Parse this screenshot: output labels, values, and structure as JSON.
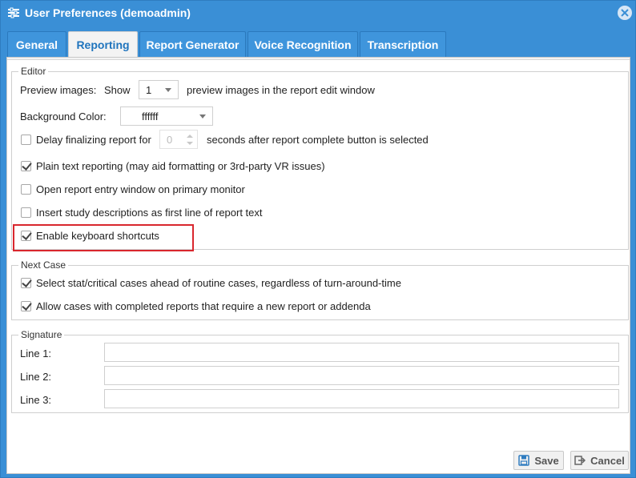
{
  "window": {
    "title": "User Preferences (demoadmin)"
  },
  "tabs": [
    {
      "label": "General",
      "active": false
    },
    {
      "label": "Reporting",
      "active": true
    },
    {
      "label": "Report Generator",
      "active": false
    },
    {
      "label": "Voice Recognition",
      "active": false
    },
    {
      "label": "Transcription",
      "active": false
    }
  ],
  "editor": {
    "legend": "Editor",
    "preview": {
      "label": "Preview images:",
      "show": "Show",
      "value": "1",
      "suffix": "preview images in the report edit window"
    },
    "background": {
      "label": "Background Color:",
      "value": "ffffff"
    },
    "delay": {
      "label": "Delay finalizing report for",
      "value": "0",
      "suffix": "seconds after report complete button is selected",
      "checked": false
    },
    "plain_text": {
      "label": "Plain text reporting (may aid formatting or 3rd-party VR issues)",
      "checked": true
    },
    "open_primary": {
      "label": "Open report entry window on primary monitor",
      "checked": false
    },
    "insert_desc": {
      "label": "Insert study descriptions as first line of report text",
      "checked": false
    },
    "shortcuts": {
      "label": "Enable keyboard shortcuts",
      "checked": true
    }
  },
  "next_case": {
    "legend": "Next Case",
    "stat": {
      "label": "Select stat/critical cases ahead of routine cases, regardless of turn-around-time",
      "checked": true
    },
    "allow": {
      "label": "Allow cases with completed reports that require a new report or addenda",
      "checked": true
    }
  },
  "signature": {
    "legend": "Signature",
    "line1": {
      "label": "Line 1:",
      "value": ""
    },
    "line2": {
      "label": "Line 2:",
      "value": ""
    },
    "line3": {
      "label": "Line 3:",
      "value": ""
    }
  },
  "buttons": {
    "save": "Save",
    "cancel": "Cancel"
  },
  "colors": {
    "window_blue": "#3a8fd6",
    "highlight_red": "#d9272e"
  }
}
